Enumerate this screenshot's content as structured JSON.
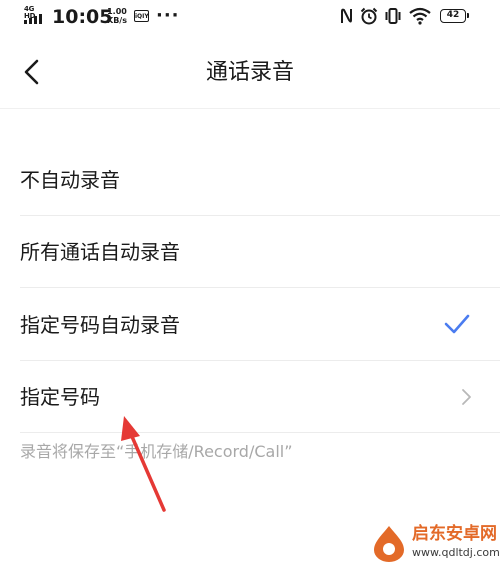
{
  "status_bar": {
    "network": "4G HD",
    "time": "10:05",
    "speed_value": "1.00",
    "speed_unit": "KB/s",
    "app_badge": "iQIY",
    "more": "···",
    "battery": "42"
  },
  "header": {
    "title": "通话录音"
  },
  "options": [
    {
      "label": "不自动录音"
    },
    {
      "label": "所有通话自动录音"
    },
    {
      "label": "指定号码自动录音",
      "selected": true
    },
    {
      "label": "指定号码"
    }
  ],
  "footer_note": "录音将保存至“手机存储/Record/Call”",
  "watermark": {
    "title": "启东安卓网",
    "url": "www.qdltdj.com"
  },
  "colors": {
    "accent": "#4a7cf0",
    "annotation_arrow": "#e53935",
    "watermark_orange": "#e36a28"
  }
}
